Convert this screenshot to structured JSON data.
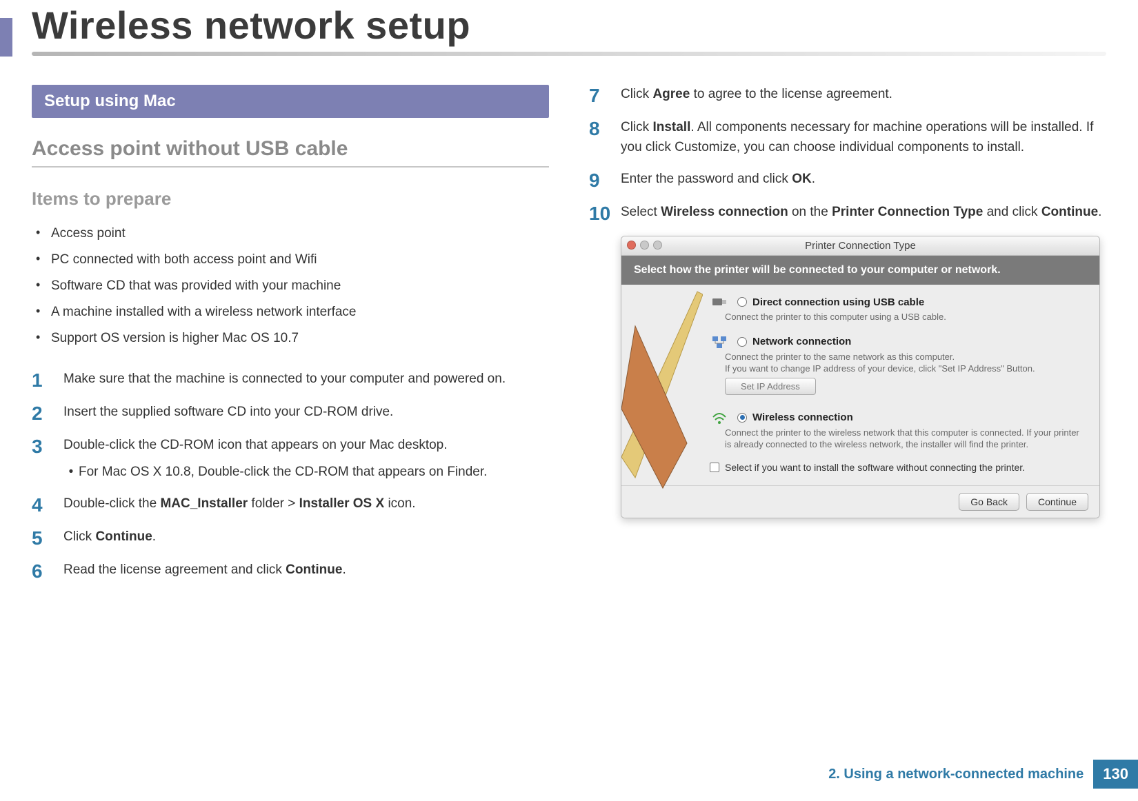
{
  "header": {
    "title": "Wireless network setup"
  },
  "left": {
    "section_band": "Setup using Mac",
    "subhead": "Access point without USB cable",
    "items_head": "Items to prepare",
    "bullets": [
      " Access point",
      "PC connected with both access point and Wifi",
      "Software CD that was provided with your machine",
      "A machine installed with a wireless network interface",
      "Support OS version is higher Mac OS 10.7"
    ],
    "steps": {
      "s1": {
        "num": "1",
        "text": "Make sure that the machine is connected to your computer and powered on."
      },
      "s2": {
        "num": "2",
        "text": "Insert the supplied software CD into your CD-ROM drive."
      },
      "s3": {
        "num": "3",
        "text_a": "Double-click the CD-ROM icon that appears on your Mac desktop.",
        "sub": "For Mac OS X 10.8, Double-click the CD-ROM that appears on Finder."
      },
      "s4": {
        "num": "4",
        "pre": "Double-click the ",
        "b1": "MAC_Installer",
        "mid": " folder > ",
        "b2": "Installer OS X",
        "post": " icon."
      },
      "s5": {
        "num": "5",
        "pre": "Click ",
        "b1": "Continue",
        "post": "."
      },
      "s6": {
        "num": "6",
        "pre": "Read the license agreement and click ",
        "b1": "Continue",
        "post": "."
      }
    }
  },
  "right": {
    "steps": {
      "s7": {
        "num": "7",
        "pre": "Click ",
        "b1": "Agree",
        "post": " to agree to the license agreement."
      },
      "s8": {
        "num": "8",
        "pre": "Click ",
        "b1": "Install",
        "post": ". All components necessary for machine operations will be installed. If you click Customize, you can choose individual components to install."
      },
      "s9": {
        "num": "9",
        "pre": "Enter the password and click ",
        "b1": "OK",
        "post": "."
      },
      "s10": {
        "num": "10",
        "pre": "Select ",
        "b1": "Wireless connection",
        "mid": " on the ",
        "b2": "Printer Connection Type",
        "mid2": " and click ",
        "b3": "Continue",
        "post": "."
      }
    },
    "dialog": {
      "title": "Printer Connection Type",
      "header": "Select how the printer will be connected to your computer or network.",
      "opt_usb": {
        "label": "Direct connection using USB cable",
        "desc": "Connect the printer to this computer using a USB cable."
      },
      "opt_net": {
        "label": "Network connection",
        "desc": "Connect the printer to the same network as this computer.\nIf you want to change IP address of your device, click \"Set IP Address\" Button."
      },
      "btn_setip": "Set IP Address",
      "opt_wifi": {
        "label": "Wireless connection",
        "desc": "Connect the printer to the wireless network that this computer is connected. If your printer is already connected to the wireless network, the installer will find the printer."
      },
      "chk": "Select if you want to install the software without connecting the printer.",
      "btn_back": "Go Back",
      "btn_continue": "Continue"
    }
  },
  "footer": {
    "chapter": "2.  Using a network-connected machine",
    "page": "130"
  }
}
